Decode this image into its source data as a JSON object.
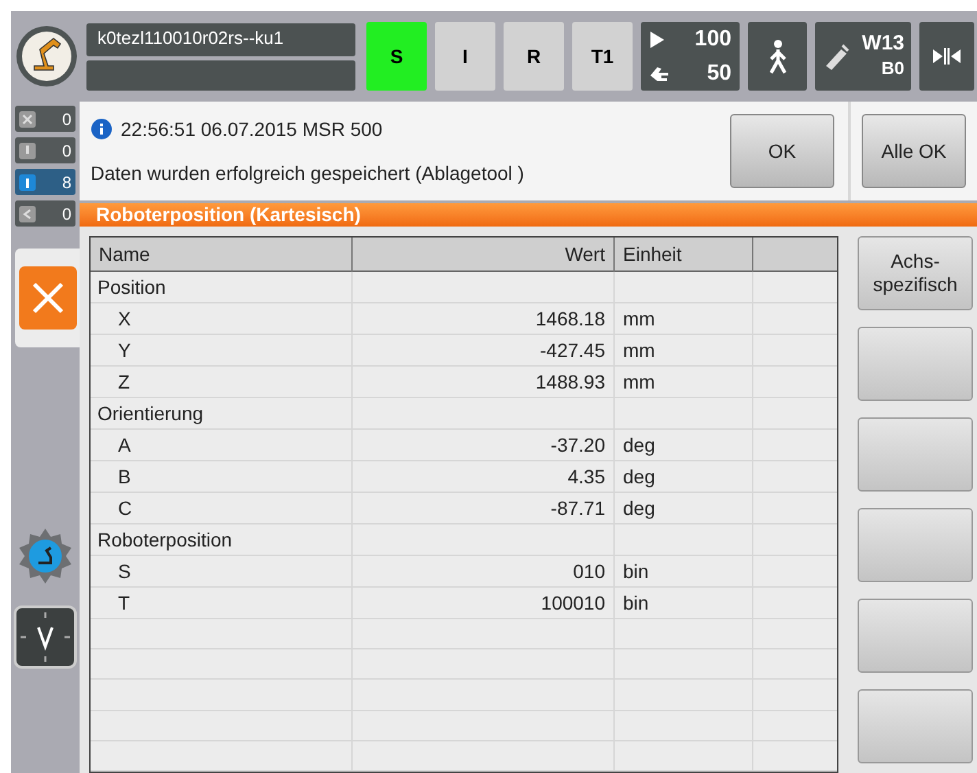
{
  "top_bar": {
    "robot_name": "k0tezl110010r02rs--ku1",
    "modes": [
      {
        "label": "S",
        "selected": true
      },
      {
        "label": "I",
        "selected": false
      },
      {
        "label": "R",
        "selected": false
      },
      {
        "label": "T1",
        "selected": false
      }
    ],
    "program_override": "100",
    "jog_override": "50",
    "tool": "W13",
    "base": "B0"
  },
  "message_counters": [
    {
      "kind": "error",
      "count": "0",
      "selected": false
    },
    {
      "kind": "warning",
      "count": "0",
      "selected": false
    },
    {
      "kind": "info",
      "count": "8",
      "selected": true
    },
    {
      "kind": "wait",
      "count": "0",
      "selected": false
    }
  ],
  "message": {
    "timestamp": "22:56:51 06.07.2015 MSR 500",
    "text": "Daten wurden erfolgreich gespeichert (Ablagetool )",
    "buttons": [
      "OK",
      "Alle OK"
    ]
  },
  "panel": {
    "title": "Roboterposition (Kartesisch)",
    "columns": [
      "Name",
      "Wert",
      "Einheit"
    ],
    "rows": [
      {
        "kind": "group",
        "name": "Position"
      },
      {
        "kind": "value",
        "name": "X",
        "value": "1468.18",
        "unit": "mm"
      },
      {
        "kind": "value",
        "name": "Y",
        "value": "-427.45",
        "unit": "mm"
      },
      {
        "kind": "value",
        "name": "Z",
        "value": "1488.93",
        "unit": "mm"
      },
      {
        "kind": "group",
        "name": "Orientierung"
      },
      {
        "kind": "value",
        "name": "A",
        "value": "-37.20",
        "unit": "deg"
      },
      {
        "kind": "value",
        "name": "B",
        "value": "4.35",
        "unit": "deg"
      },
      {
        "kind": "value",
        "name": "C",
        "value": "-87.71",
        "unit": "deg"
      },
      {
        "kind": "group",
        "name": "Roboterposition"
      },
      {
        "kind": "value",
        "name": "S",
        "value": "010",
        "unit": "bin"
      },
      {
        "kind": "value",
        "name": "T",
        "value": "100010",
        "unit": "bin"
      }
    ],
    "side_buttons": [
      "Achs-\nspezifisch"
    ]
  }
}
